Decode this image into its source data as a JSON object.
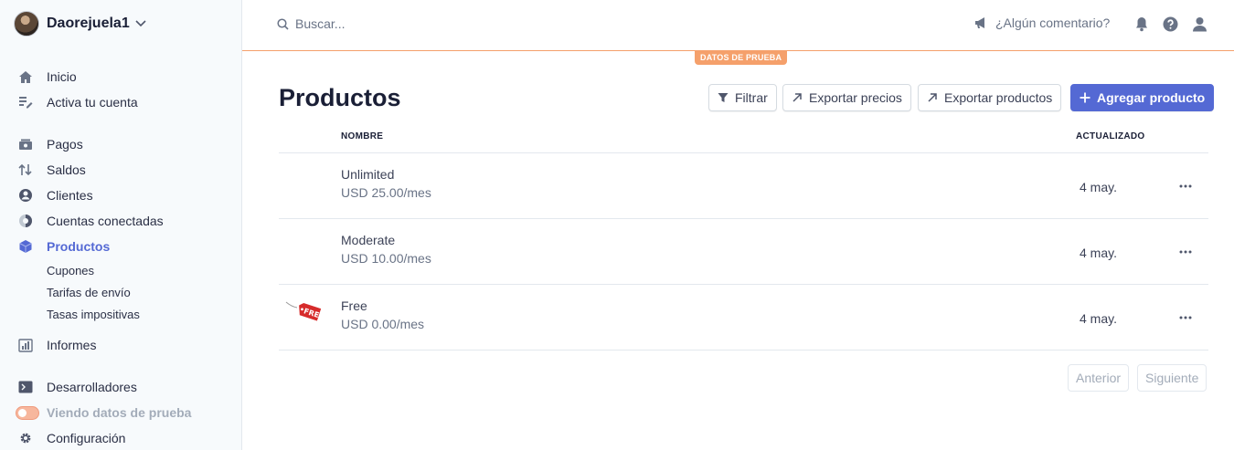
{
  "account": {
    "name": "Daorejuela1"
  },
  "nav": {
    "home": "Inicio",
    "activate": "Activa tu cuenta",
    "payments": "Pagos",
    "balances": "Saldos",
    "customers": "Clientes",
    "connected": "Cuentas conectadas",
    "products": "Productos",
    "coupons": "Cupones",
    "shipping": "Tarifas de envío",
    "taxes": "Tasas impositivas",
    "reports": "Informes",
    "developers": "Desarrolladores",
    "test_data": "Viendo datos de prueba",
    "settings": "Configuración"
  },
  "topbar": {
    "search_placeholder": "Buscar...",
    "feedback": "¿Algún comentario?",
    "test_badge": "DATOS DE PRUEBA"
  },
  "page": {
    "title": "Productos",
    "filter": "Filtrar",
    "export_prices": "Exportar precios",
    "export_products": "Exportar productos",
    "add_product": "Agregar producto"
  },
  "table": {
    "col_name": "NOMBRE",
    "col_updated": "ACTUALIZADO",
    "rows": [
      {
        "name": "Unlimited",
        "price": "USD 25.00/mes",
        "updated": "4 may."
      },
      {
        "name": "Moderate",
        "price": "USD 10.00/mes",
        "updated": "4 may."
      },
      {
        "name": "Free",
        "price": "USD 0.00/mes",
        "updated": "4 may.",
        "thumb_text": "FREE"
      }
    ]
  },
  "pagination": {
    "prev": "Anterior",
    "next": "Siguiente"
  },
  "colors": {
    "accent": "#5469d4",
    "test_mode": "#f5a06b"
  }
}
